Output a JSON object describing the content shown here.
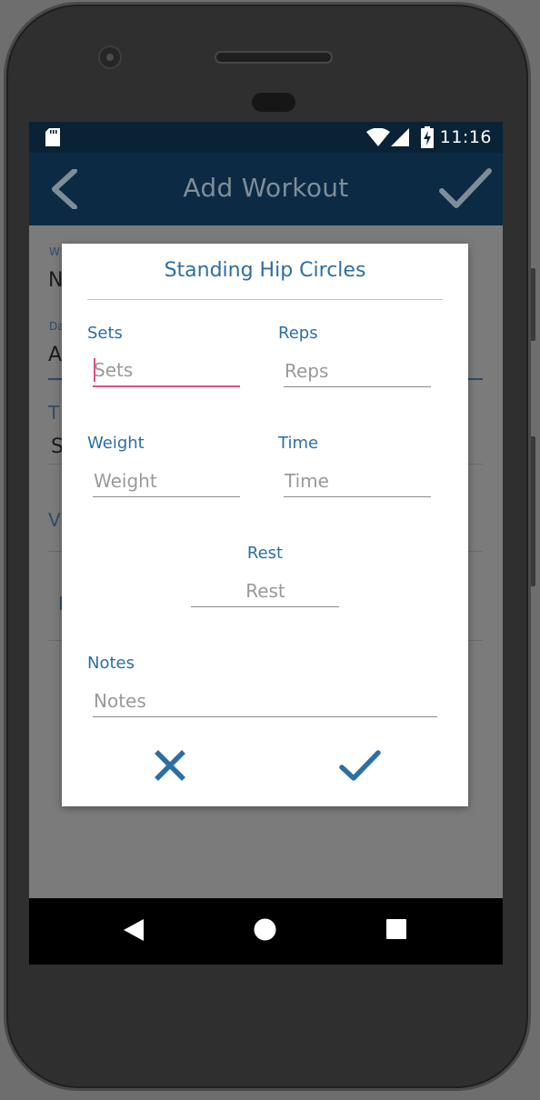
{
  "status_bar": {
    "time": "11:16"
  },
  "app_bar": {
    "title": "Add Workout"
  },
  "background_form": {
    "row1_char": "N",
    "row2_char": "A",
    "row3_label_char": "T",
    "row3_char": "S",
    "row4_char": "V",
    "row5_char": "I"
  },
  "dialog": {
    "title": "Standing Hip Circles",
    "fields": {
      "sets": {
        "label": "Sets",
        "placeholder": "Sets",
        "value": ""
      },
      "reps": {
        "label": "Reps",
        "placeholder": "Reps",
        "value": ""
      },
      "weight": {
        "label": "Weight",
        "placeholder": "Weight",
        "value": ""
      },
      "time": {
        "label": "Time",
        "placeholder": "Time",
        "value": ""
      },
      "rest": {
        "label": "Rest",
        "placeholder": "Rest",
        "value": ""
      },
      "notes": {
        "label": "Notes",
        "placeholder": "Notes",
        "value": ""
      }
    },
    "cancel_icon": "close-icon",
    "confirm_icon": "check-icon"
  },
  "colors": {
    "accent": "#2d6fa3",
    "focus": "#e24d88",
    "app_bar": "#0c2a43",
    "status_bar": "#0a2236"
  }
}
